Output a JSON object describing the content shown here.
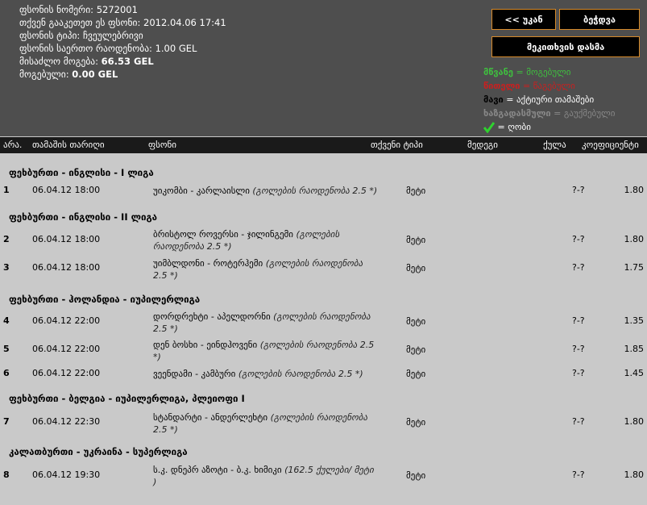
{
  "ticket": {
    "number_label": "ფსონის ნომერი:",
    "number_value": "5272001",
    "placed_label": "თქვენ გააკეთეთ ეს ფსონი:",
    "placed_value": "2012.04.06 17:41",
    "type_label": "ფსონის ტიპი:",
    "type_value": "ჩვეულებრივი",
    "stake_label": "ფსონის საერთო რაოდენობა:",
    "stake_value": "1.00 GEL",
    "possible_label": "მისაძლო მოგება:",
    "possible_value": "66.53 GEL",
    "won_label": "მოგებული:",
    "won_value": "0.00 GEL"
  },
  "buttons": {
    "back": "<< უკან",
    "print": "ბეჭდვა",
    "repeat": "მეკითხვის დასმა"
  },
  "legend": {
    "green_key": "მწვანე",
    "green_val": "= მოგებული",
    "red_key": "წითელი",
    "red_val": "= წაგებული",
    "black_key": "მავი",
    "black_val": "= აქტიური თამაშები",
    "strike_key": "ხაზგადასმული",
    "strike_val": "= გაუქმებული",
    "check_val": "= ღობი"
  },
  "table": {
    "headers": [
      "არა.",
      "თამაშის თარიღი",
      "ფსონი",
      "თქვენი ტიპი",
      "მედეგი",
      "ქულა",
      "კოეფიციენტი"
    ]
  },
  "sections": [
    {
      "title": "ფეხბურთი - ინგლისი - I ლიგა",
      "rows": [
        {
          "num": "1",
          "date": "06.04.12 18:00",
          "event": "უიკომბი - კარლაისლი",
          "detail": "(გოლების რაოდენობა 2.5 *)",
          "type": "მეტი",
          "score": "?-?",
          "coef": "1.80"
        }
      ]
    },
    {
      "title": "ფეხბურთი - ინგლისი - II ლიგა",
      "rows": [
        {
          "num": "2",
          "date": "06.04.12 18:00",
          "event": "ბრისტოლ როვერსი - ჯილინგემი",
          "detail": "(გოლების რაოდენობა 2.5 *)",
          "type": "მეტი",
          "score": "?-?",
          "coef": "1.80"
        },
        {
          "num": "3",
          "date": "06.04.12 18:00",
          "event": "უიმბლდონი - როტერჰემი",
          "detail": "(გოლების რაოდენობა 2.5 *)",
          "type": "მეტი",
          "score": "?-?",
          "coef": "1.75"
        }
      ]
    },
    {
      "title": "ფეხბურთი - ჰოლანდია - იუპილერლიგა",
      "rows": [
        {
          "num": "4",
          "date": "06.04.12 22:00",
          "event": "დორდრეხტი - აპელდორნი",
          "detail": "(გოლების რაოდენობა 2.5 *)",
          "type": "მეტი",
          "score": "?-?",
          "coef": "1.35"
        },
        {
          "num": "5",
          "date": "06.04.12 22:00",
          "event": "დენ ბოსხი - ეინდჰოვენი",
          "detail": "(გოლების რაოდენობა 2.5 *)",
          "type": "მეტი",
          "score": "?-?",
          "coef": "1.85"
        },
        {
          "num": "6",
          "date": "06.04.12 22:00",
          "event": "ვეენდამი - კამბური",
          "detail": "(გოლების რაოდენობა 2.5 *)",
          "type": "მეტი",
          "score": "?-?",
          "coef": "1.45"
        }
      ]
    },
    {
      "title": "ფეხბურთი - ბელგია - იუპილერლიგა, პლეიოფი I",
      "rows": [
        {
          "num": "7",
          "date": "06.04.12 22:30",
          "event": "სტანდარტი - ანდერლეხტი",
          "detail": "(გოლების რაოდენობა 2.5 *)",
          "type": "მეტი",
          "score": "?-?",
          "coef": "1.80"
        }
      ]
    },
    {
      "title": "კალათბურთი - უკრაინა - სუპერლიგა",
      "rows": [
        {
          "num": "8",
          "date": "06.04.12 19:30",
          "event": "ს.კ. დნეპრ აზოტი - ბ.კ. ხიმიკი",
          "detail": "(162.5 ქულები/ მეტი )",
          "type": "მეტი",
          "score": "?-?",
          "coef": "1.80"
        }
      ]
    }
  ]
}
